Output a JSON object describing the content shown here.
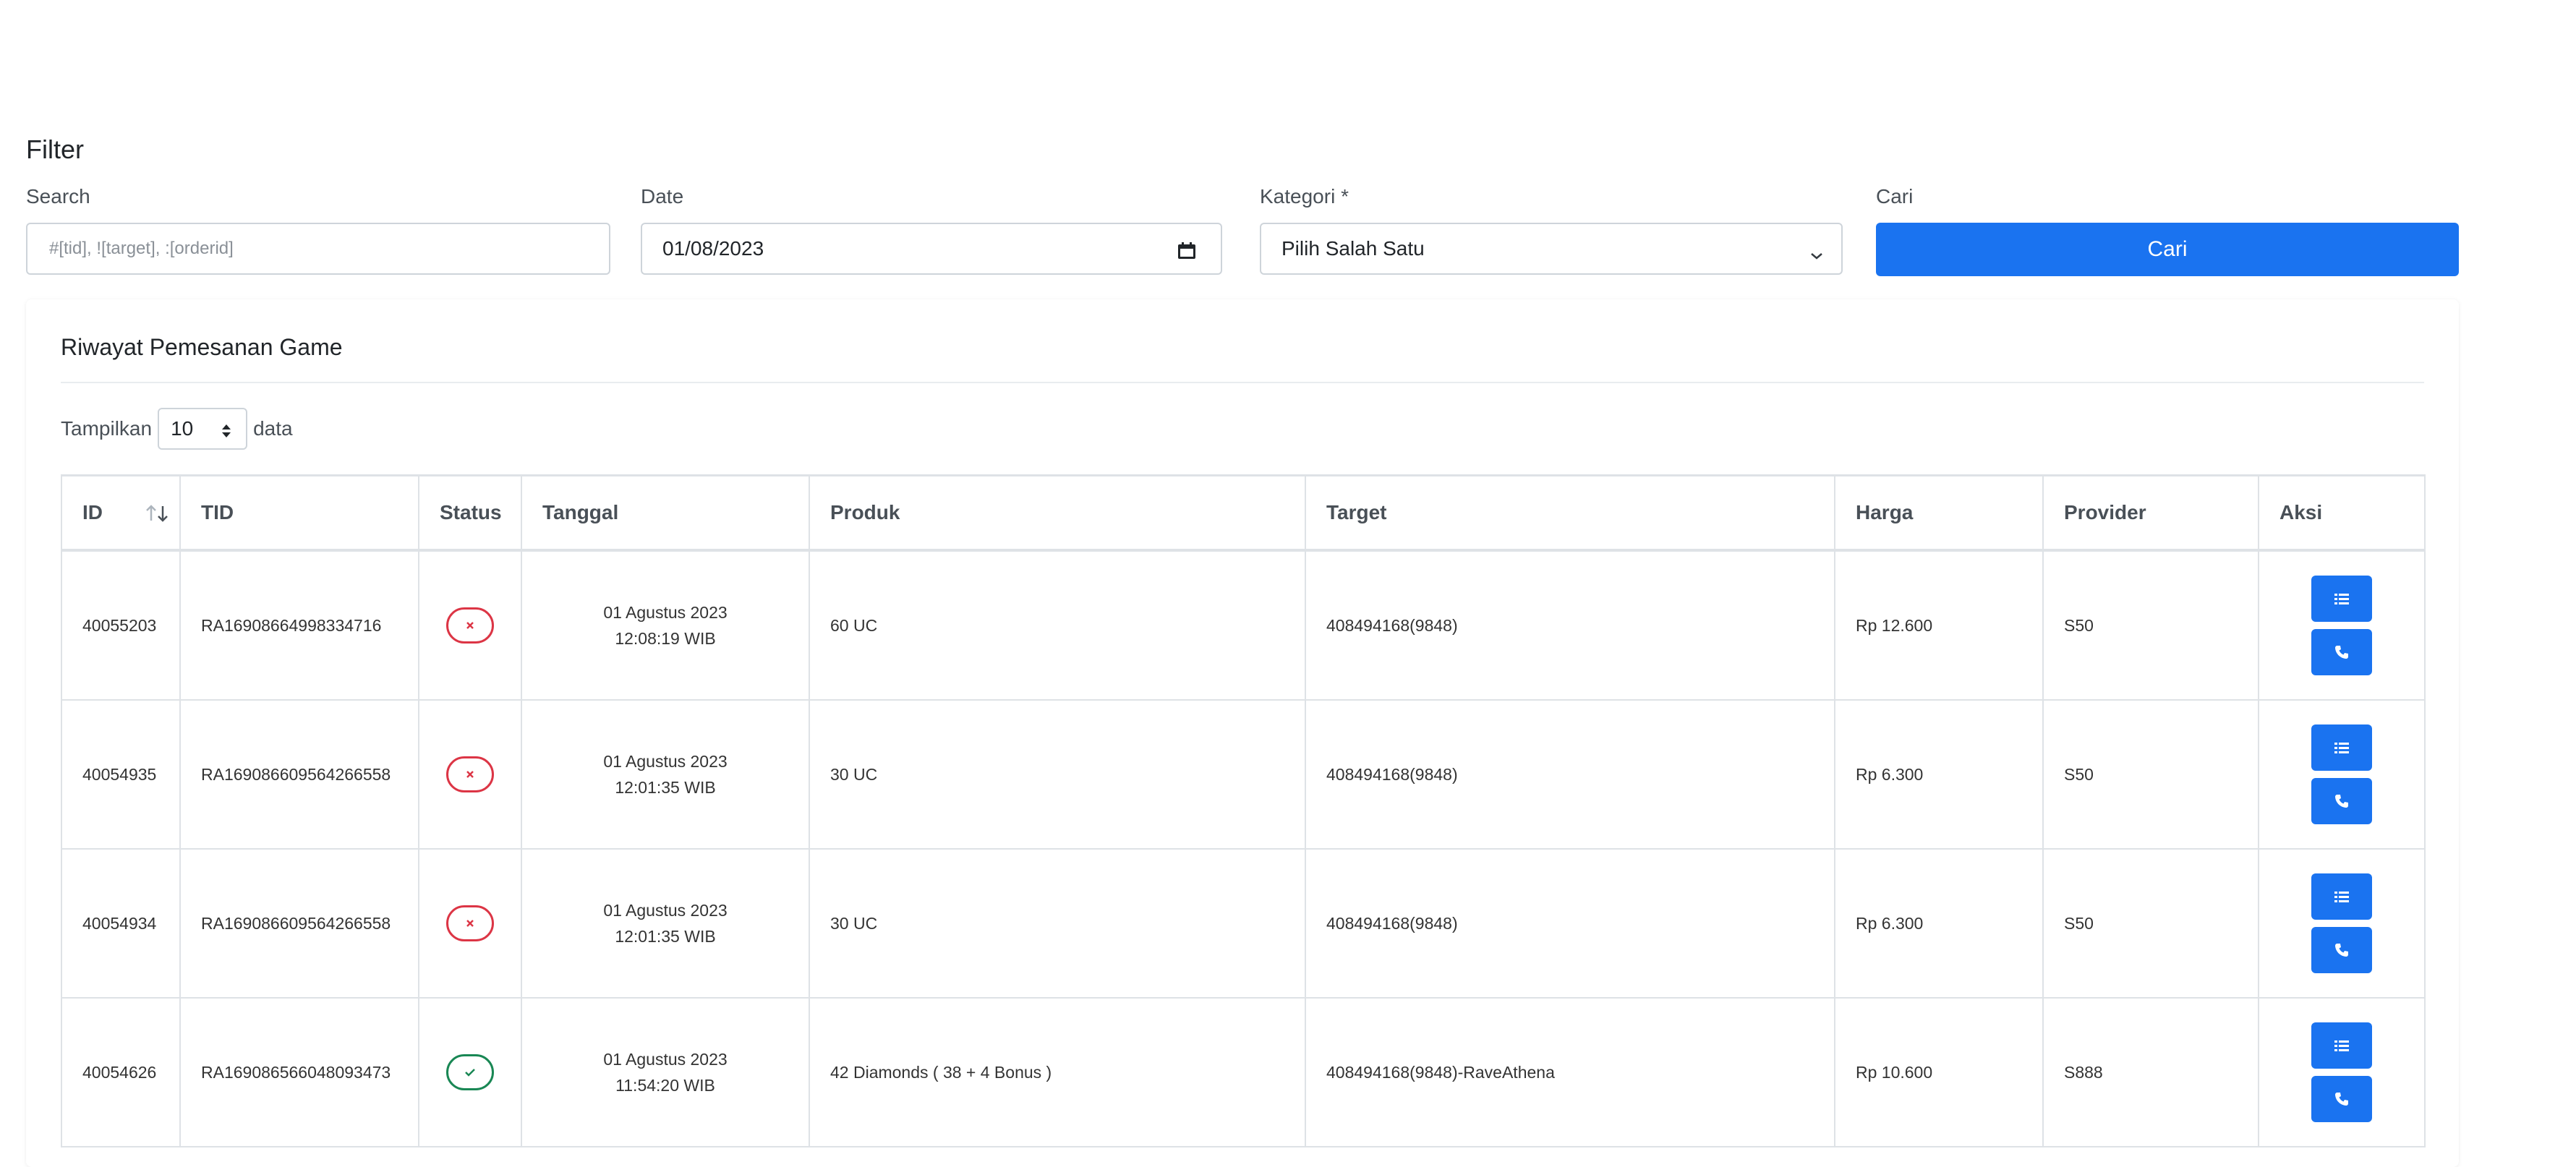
{
  "filter": {
    "title": "Filter",
    "search": {
      "label": "Search",
      "placeholder": "#[tid], ![target], :[orderid]",
      "value": ""
    },
    "date": {
      "label": "Date",
      "value": "01/08/2023"
    },
    "kategori": {
      "label": "Kategori *",
      "selected": "Pilih Salah Satu"
    },
    "cari": {
      "label": "Cari",
      "button_label": "Cari"
    }
  },
  "card": {
    "title": "Riwayat Pemesanan Game",
    "length": {
      "prefix": "Tampilkan",
      "value": "10",
      "suffix": "data"
    }
  },
  "table": {
    "columns": [
      "ID",
      "TID",
      "Status",
      "Tanggal",
      "Produk",
      "Target",
      "Harga",
      "Provider",
      "Aksi"
    ],
    "rows": [
      {
        "id": "40055203",
        "tid": "RA16908664998334716",
        "status": "failed",
        "date": "01 Agustus 2023",
        "time": "12:08:19 WIB",
        "produk": "60 UC",
        "target": "408494168(9848)",
        "harga": "Rp 12.600",
        "provider": "S50"
      },
      {
        "id": "40054935",
        "tid": "RA169086609564266558",
        "status": "failed",
        "date": "01 Agustus 2023",
        "time": "12:01:35 WIB",
        "produk": "30 UC",
        "target": "408494168(9848)",
        "harga": "Rp 6.300",
        "provider": "S50"
      },
      {
        "id": "40054934",
        "tid": "RA169086609564266558",
        "status": "failed",
        "date": "01 Agustus 2023",
        "time": "12:01:35 WIB",
        "produk": "30 UC",
        "target": "408494168(9848)",
        "harga": "Rp 6.300",
        "provider": "S50"
      },
      {
        "id": "40054626",
        "tid": "RA169086566048093473",
        "status": "success",
        "date": "01 Agustus 2023",
        "time": "11:54:20 WIB",
        "produk": "42 Diamonds ( 38 + 4 Bonus )",
        "target": "408494168(9848)-RaveAthena",
        "harga": "Rp 10.600",
        "provider": "S888"
      }
    ]
  },
  "colors": {
    "primary": "#1a73f0",
    "danger": "#dc3545",
    "success": "#198754",
    "border": "#dee2e6"
  },
  "icons": {
    "status_failed": "x-icon",
    "status_success": "check-icon",
    "detail": "list-icon",
    "contact": "phone-icon",
    "sort": "sort-icon"
  }
}
